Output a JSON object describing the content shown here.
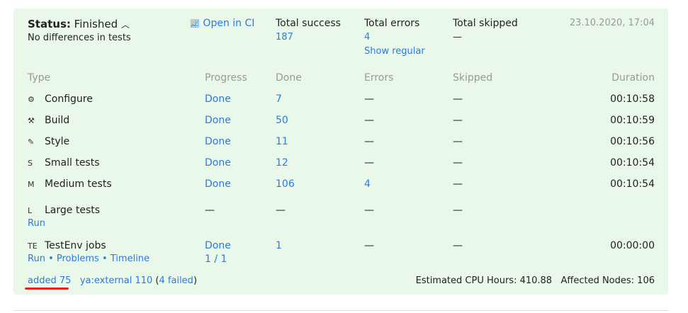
{
  "status": {
    "label": "Status:",
    "value": "Finished",
    "subtitle": "No differences in tests"
  },
  "open_ci": "Open in CI",
  "summary": [
    {
      "label": "Total success",
      "value": "187"
    },
    {
      "label": "Total errors",
      "value": "4",
      "extra": "Show regular"
    },
    {
      "label": "Total skipped",
      "value": "—"
    }
  ],
  "date": "23.10.2020, 17:04",
  "columns": [
    "Type",
    "Progress",
    "Done",
    "Errors",
    "Skipped",
    "Duration"
  ],
  "rows": [
    {
      "icon": "⚙",
      "name": "Configure",
      "progress": "Done",
      "done": "7",
      "errors": "—",
      "skipped": "—",
      "duration": "00:10:58"
    },
    {
      "icon": "⚒",
      "name": "Build",
      "progress": "Done",
      "done": "50",
      "errors": "—",
      "skipped": "—",
      "duration": "00:10:59"
    },
    {
      "icon": "✎",
      "name": "Style",
      "progress": "Done",
      "done": "11",
      "errors": "—",
      "skipped": "—",
      "duration": "00:10:56"
    },
    {
      "icon": "S",
      "name": "Small tests",
      "progress": "Done",
      "done": "12",
      "errors": "—",
      "skipped": "—",
      "duration": "00:10:54"
    },
    {
      "icon": "M",
      "name": "Medium tests",
      "progress": "Done",
      "done": "106",
      "errors": "4",
      "skipped": "—",
      "duration": "00:10:54"
    },
    {
      "icon": "L",
      "name": "Large tests",
      "progress": "—",
      "done": "—",
      "errors": "—",
      "skipped": "—",
      "duration": "",
      "links": [
        "Run"
      ]
    },
    {
      "icon": "TE",
      "name": "TestEnv jobs",
      "progress": "Done",
      "progress2": "1 / 1",
      "done": "1",
      "errors": "—",
      "skipped": "—",
      "duration": "00:00:00",
      "links": [
        "Run",
        "Problems",
        "Timeline"
      ]
    }
  ],
  "footer": {
    "added": "added 75",
    "external": "ya:external 110",
    "failed": "4 failed",
    "cpu": "Estimated CPU Hours: 410.88",
    "nodes": "Affected Nodes: 106"
  },
  "colors": {
    "panel": "#eaf8ea",
    "link": "#2a7ae2",
    "underline": "#e32222"
  }
}
